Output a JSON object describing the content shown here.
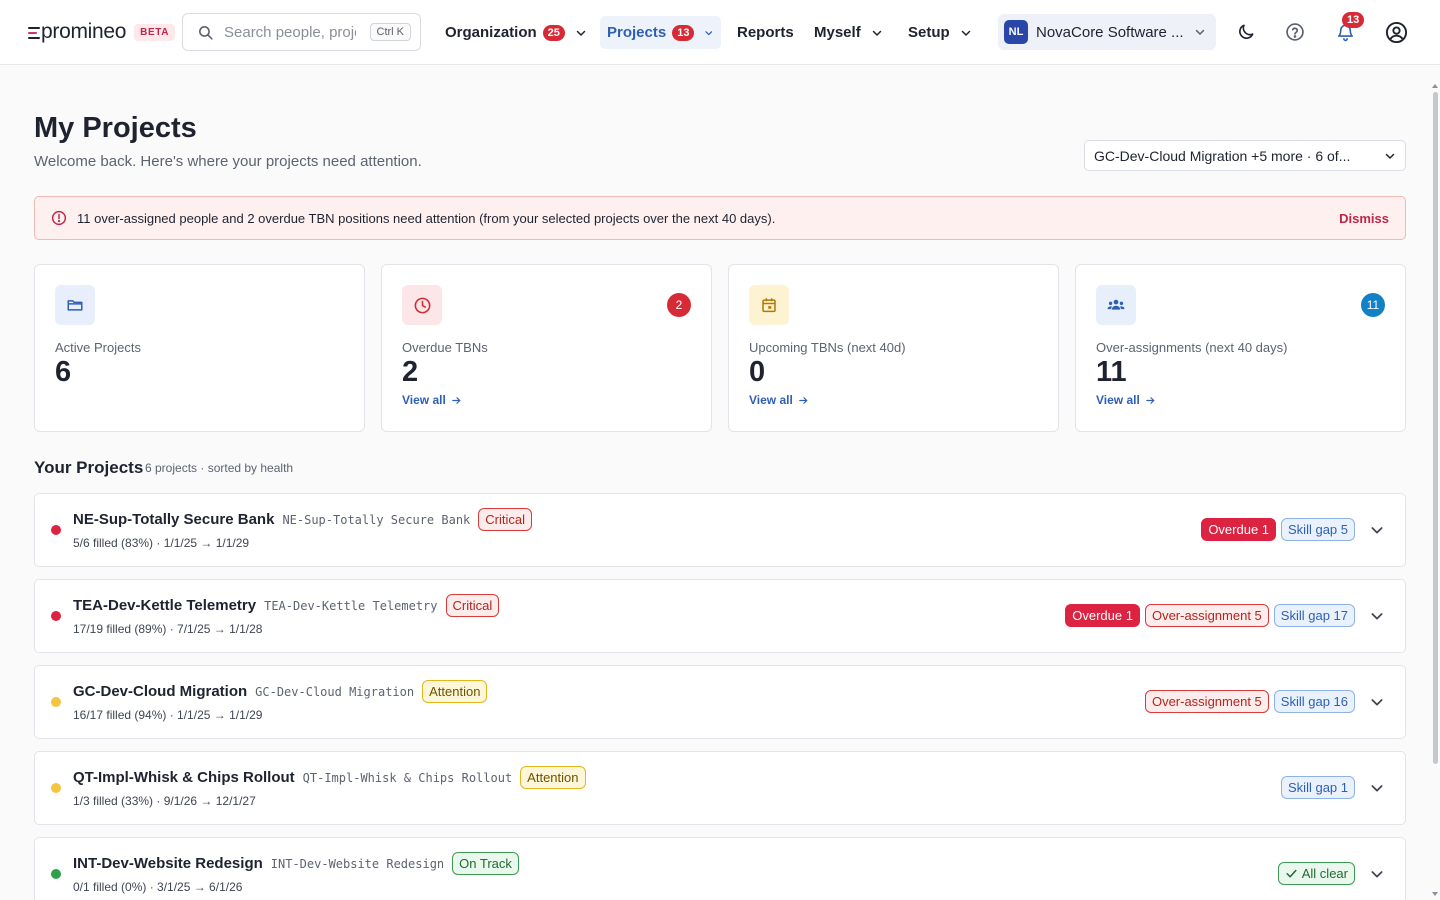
{
  "brand": {
    "name": "promineo",
    "badge": "BETA"
  },
  "search": {
    "placeholder": "Search people, projects",
    "shortcut": "Ctrl K"
  },
  "nav": {
    "organization": {
      "label": "Organization",
      "count": "25"
    },
    "projects": {
      "label": "Projects",
      "count": "13"
    },
    "reports": {
      "label": "Reports"
    },
    "myself": {
      "label": "Myself"
    },
    "setup": {
      "label": "Setup"
    }
  },
  "org_switcher": {
    "initials": "NL",
    "name": "NovaCore Software ..."
  },
  "notifications": {
    "count": "13"
  },
  "icons": {
    "theme": "moon-icon",
    "help": "help-circle-icon",
    "notifications": "bell-icon",
    "account": "user-circle-icon"
  },
  "page": {
    "title": "My Projects",
    "subtitle": "Welcome back. Here's where your projects need attention.",
    "project_filter": "GC-Dev-Cloud Migration +5 more · 6 of..."
  },
  "alert": {
    "message": "11 over-assigned people and 2 overdue TBN positions need attention (from your selected projects over the next 40 days).",
    "dismiss": "Dismiss"
  },
  "stats": [
    {
      "label": "Active Projects",
      "value": "6",
      "icon": "folder-icon"
    },
    {
      "label": "Overdue TBNs",
      "value": "2",
      "icon": "clock-icon",
      "count": "2",
      "link": "View all"
    },
    {
      "label": "Upcoming TBNs (next 40d)",
      "value": "0",
      "icon": "calendar-icon",
      "link": "View all"
    },
    {
      "label": "Over-assignments (next 40 days)",
      "value": "11",
      "icon": "users-icon",
      "count": "11",
      "link": "View all"
    }
  ],
  "colors": {
    "accent": "#2f5fb3",
    "critical": "#dc2341",
    "attention": "#f5c542",
    "on_track": "#2fa14d",
    "overdue_count": "#d62b36",
    "over_assign_count": "#1281c6"
  },
  "section": {
    "title": "Your Projects",
    "meta": "6 projects · sorted by health"
  },
  "projects": [
    {
      "name": "NE-Sup-Totally Secure Bank",
      "code": "NE-Sup-Totally Secure Bank",
      "health": "Critical",
      "meta": "5/6 filled (83%)  · 1/1/25 → 1/1/29",
      "chips": {
        "overdue": "Overdue 1",
        "skill_gap": "Skill gap 5"
      }
    },
    {
      "name": "TEA-Dev-Kettle Telemetry",
      "code": "TEA-Dev-Kettle Telemetry",
      "health": "Critical",
      "meta": "17/19 filled (89%)  · 7/1/25 → 1/1/28",
      "chips": {
        "overdue": "Overdue 1",
        "over_assignment": "Over-assignment 5",
        "skill_gap": "Skill gap 17"
      }
    },
    {
      "name": "GC-Dev-Cloud Migration",
      "code": "GC-Dev-Cloud Migration",
      "health": "Attention",
      "meta": "16/17 filled (94%)  · 1/1/25 → 1/1/29",
      "chips": {
        "over_assignment": "Over-assignment 5",
        "skill_gap": "Skill gap 16"
      }
    },
    {
      "name": "QT-Impl-Whisk & Chips Rollout",
      "code": "QT-Impl-Whisk & Chips Rollout",
      "health": "Attention",
      "meta": "1/3 filled (33%)  · 9/1/26 → 12/1/27",
      "chips": {
        "skill_gap": "Skill gap 1"
      }
    },
    {
      "name": "INT-Dev-Website Redesign",
      "code": "INT-Dev-Website Redesign",
      "health": "On Track",
      "meta": "0/1 filled (0%)  · 3/1/25 → 6/1/26",
      "chips": {
        "all_clear": "All clear"
      }
    }
  ]
}
